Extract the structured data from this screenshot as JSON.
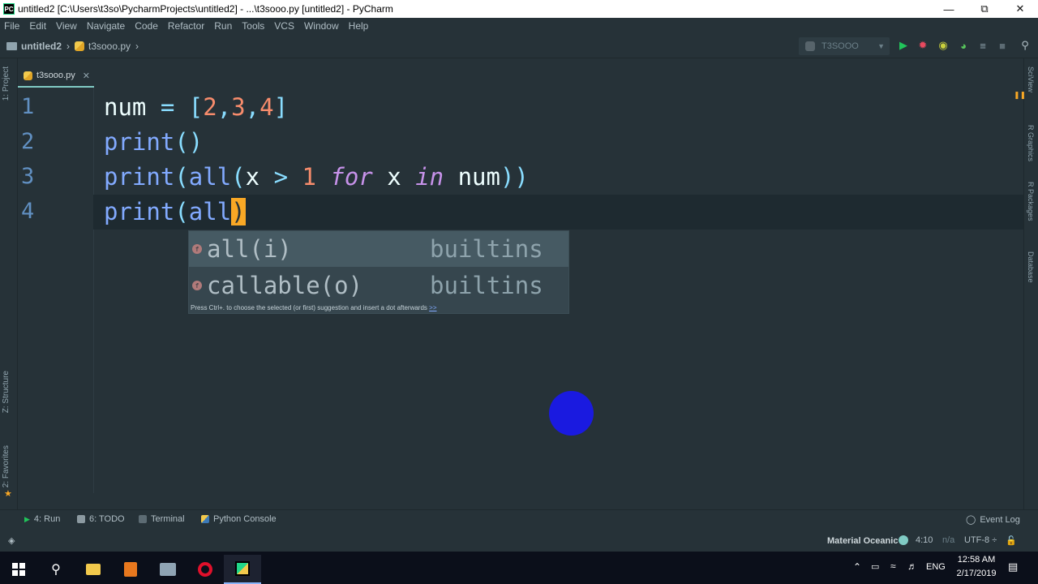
{
  "window": {
    "app_icon": "PC",
    "title": "untitled2 [C:\\Users\\t3so\\PycharmProjects\\untitled2] - ...\\t3sooo.py [untitled2] - PyCharm",
    "controls": [
      "minimize-icon",
      "restore-icon",
      "close-icon"
    ]
  },
  "menu": [
    "File",
    "Edit",
    "View",
    "Navigate",
    "Code",
    "Refactor",
    "Run",
    "Tools",
    "VCS",
    "Window",
    "Help"
  ],
  "navbar": {
    "project": "untitled2",
    "file": "t3sooo.py",
    "run_config": "T3SOOO"
  },
  "left_strip": {
    "project": "1: Project",
    "structure": "Z: Structure",
    "favorites": "2: Favorites"
  },
  "right_strip": {
    "sciview": "SciView",
    "r_graphics": "R Graphics",
    "r_packages": "R Packages",
    "database": "Database"
  },
  "editor": {
    "tab_label": "t3sooo.py",
    "line_numbers": [
      "1",
      "2",
      "3",
      "4"
    ],
    "line1": {
      "a": "num ",
      "b": "= ",
      "c": "[",
      "d": "2",
      "e": ",",
      "f": "3",
      "g": ",",
      "h": "4",
      "i": "]"
    },
    "line2": {
      "a": "print",
      "b": "()"
    },
    "line3": {
      "a": "print",
      "b": "(",
      "c": "all",
      "d": "(",
      "e": "x ",
      "f": "> ",
      "g": "1 ",
      "h": "for",
      "i": " x ",
      "j": "in",
      "k": " num",
      "l": "))"
    },
    "line4": {
      "a": "print",
      "b": "(",
      "c": "all",
      "d": ")"
    }
  },
  "completion": {
    "items": [
      {
        "name": "all(i)",
        "source": "builtins"
      },
      {
        "name": "callable(o)",
        "source": "builtins"
      }
    ],
    "hint": "Press Ctrl+. to choose the selected (or first) suggestion and insert a dot afterwards",
    "hint_link": ">>"
  },
  "bottom_tools": {
    "run": "4: Run",
    "todo": "6: TODO",
    "terminal": "Terminal",
    "python_console": "Python Console",
    "event_log": "Event Log"
  },
  "status": {
    "theme": "Material Oceanic",
    "position": "4:10",
    "na": "n/a",
    "encoding": "UTF-8 ÷"
  },
  "taskbar": {
    "language": "ENG",
    "time": "12:58 AM",
    "date": "2/17/2019"
  },
  "colors": {
    "editor_bg": "#263238",
    "keyword": "#c792ea",
    "function": "#82aaff",
    "number": "#f78c6c",
    "bracket_match": "#f9a825",
    "cursor_dot": "#1a1ae0"
  }
}
